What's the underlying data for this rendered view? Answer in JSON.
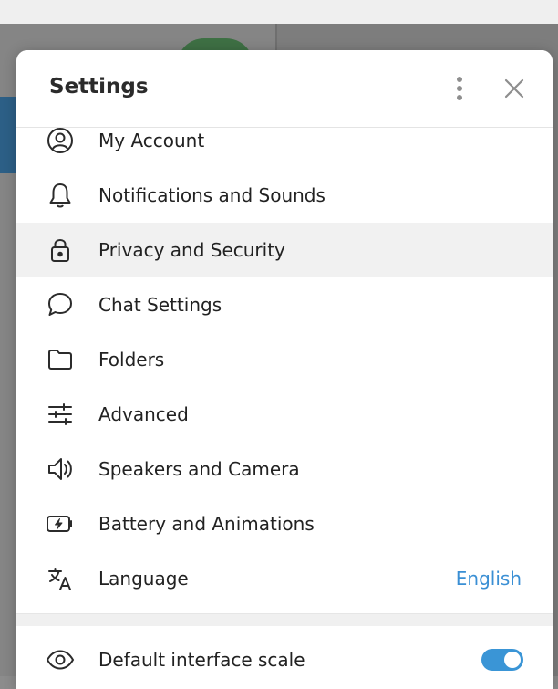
{
  "dialog": {
    "title": "Settings"
  },
  "menu": {
    "items": [
      {
        "label": "My Account",
        "icon": "account-circle-icon"
      },
      {
        "label": "Notifications and Sounds",
        "icon": "bell-icon"
      },
      {
        "label": "Privacy and Security",
        "icon": "lock-icon"
      },
      {
        "label": "Chat Settings",
        "icon": "chat-bubble-icon"
      },
      {
        "label": "Folders",
        "icon": "folder-icon"
      },
      {
        "label": "Advanced",
        "icon": "sliders-icon"
      },
      {
        "label": "Speakers and Camera",
        "icon": "speaker-icon"
      },
      {
        "label": "Battery and Animations",
        "icon": "battery-charging-icon"
      },
      {
        "label": "Language",
        "icon": "translate-icon",
        "value": "English"
      }
    ]
  },
  "scale": {
    "label": "Default interface scale",
    "icon": "eye-icon",
    "enabled": true
  },
  "colors": {
    "accent": "#3a95d6",
    "link": "#3a8fd4",
    "hover_row": "#f1f1f1"
  }
}
